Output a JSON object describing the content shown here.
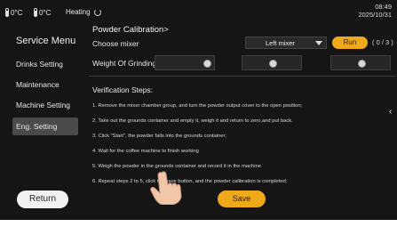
{
  "status": {
    "temp1": "0°C",
    "temp2": "0°C",
    "heating": "Heating",
    "time": "08:49",
    "date": "2025/10/31"
  },
  "sidebar": {
    "title": "Service Menu",
    "items": [
      {
        "label": "Drinks Setting"
      },
      {
        "label": "Maintenance"
      },
      {
        "label": "Machine Setting"
      },
      {
        "label": "Eng. Setting"
      }
    ],
    "return_label": "Return"
  },
  "main": {
    "title": "Powder Calibration>",
    "choose_mixer_label": "Choose mixer",
    "mixer_value": "Left mixer",
    "run_label": "Run",
    "run_count": "( 0 / 3 )",
    "grinding_label": "Weight Of Grinding",
    "steps_title": "Verification Steps:",
    "steps": [
      "1. Remove the mixer chamber group, and turn the powder output cover to the open position;",
      "2. Take out the grounds container and empty it, weigh it and return to zero,and put back.",
      "3. Click \"Start\", the powder falls into the grounds container;",
      "4. Wait for the coffee machine to finish working",
      "5. Weigh the powder in the grounds container and record it in the machine",
      "6. Repeat steps 2 to 5, click the save button, and the powder calibration is completed;"
    ],
    "save_label": "Save"
  },
  "colors": {
    "background": "#151515",
    "accent": "#f0a91a",
    "active_item": "#4a4a4a"
  },
  "icons": [
    "thermometer-icon",
    "spinner-icon",
    "dropdown-caret-icon",
    "grinder-icon",
    "chevron-left-icon"
  ]
}
